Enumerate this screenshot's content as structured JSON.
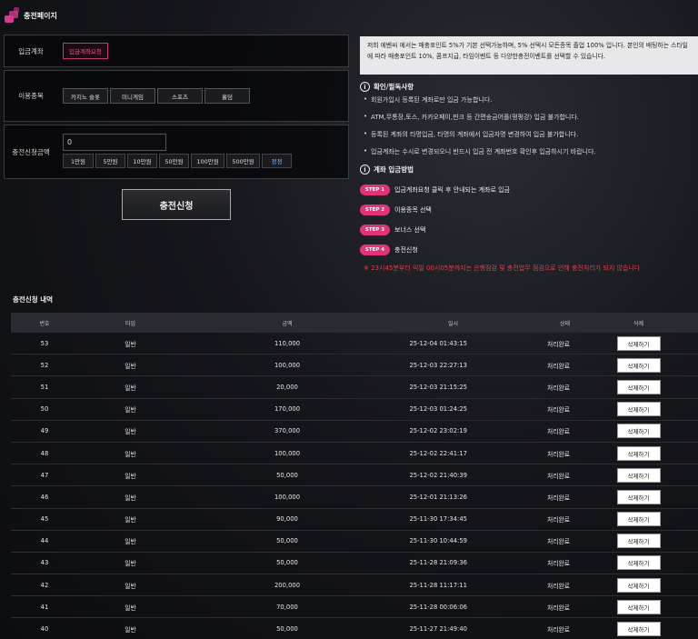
{
  "page": {
    "title": "충전페이지"
  },
  "form": {
    "account_label": "입금계좌",
    "account_button": "입금계좌요청",
    "category_label": "이용종목",
    "categories": [
      "카지노 슬롯",
      "미니게임",
      "스포츠",
      "홀덤"
    ],
    "amount_label": "충전신청금액",
    "amount_value": "0",
    "amount_buttons": [
      "1만원",
      "5만원",
      "10만원",
      "50만원",
      "100만원",
      "500만원"
    ],
    "reset_label": "정정",
    "submit_label": "충전신청"
  },
  "info": {
    "notice": "저희 에벤씨 에서는 매충포인트 5%가 기본 선택가능하며, 5% 선택시 모든종목 졸업 100% 입니다. 본인의 배팅하는 스타일에 따라 매충포인트 10%, 콤프지급, 타임이벤트 등 다양한충전이벤트를 선택할 수 있습니다.",
    "notes_title": "확인/필독사항",
    "notes": [
      "회원가입시 등록된 계좌로만 입금 가능합니다.",
      "ATM,무통장,토스, 카카오페이,핀크 등 간편송금어플(펑펑강) 입금 불가합니다.",
      "등록된 계좌의 타명입금, 타명의 계좌에서 입금자명 변경하여 입금 불가합니다.",
      "입금계좌는 수시로 변경되오니 반드시 입금 전 계좌번호 확인후 입금하시기 바랍니다."
    ],
    "method_title": "계좌 입금방법",
    "steps": [
      {
        "badge": "STEP 1",
        "text": "입금계좌요청 클릭 후 안내되는 계좌로 입금"
      },
      {
        "badge": "STEP 2",
        "text": "이용종목 선택"
      },
      {
        "badge": "STEP 3",
        "text": "보너스 선택"
      },
      {
        "badge": "STEP 4",
        "text": "충전신청"
      }
    ],
    "warning": "※ 23시45분부터 익일 00시05분까지는 은행점검 및 충전업무 점검으로 인해 충전처리가 되지 않습니다"
  },
  "history": {
    "title": "충전신청 내역",
    "columns": [
      "번호",
      "타입",
      "금액",
      "일시",
      "상태",
      "삭제"
    ],
    "delete_label": "삭제하기",
    "rows": [
      {
        "no": "53",
        "type": "일반",
        "amount": "110,000",
        "date": "25-12-04 01:43:15",
        "status": "처리완료"
      },
      {
        "no": "52",
        "type": "일반",
        "amount": "100,000",
        "date": "25-12-03 22:27:13",
        "status": "처리완료"
      },
      {
        "no": "51",
        "type": "일반",
        "amount": "20,000",
        "date": "25-12-03 21:15:25",
        "status": "처리완료"
      },
      {
        "no": "50",
        "type": "일반",
        "amount": "170,000",
        "date": "25-12-03 01:24:25",
        "status": "처리완료"
      },
      {
        "no": "49",
        "type": "일반",
        "amount": "370,000",
        "date": "25-12-02 23:02:19",
        "status": "처리완료"
      },
      {
        "no": "48",
        "type": "일반",
        "amount": "100,000",
        "date": "25-12-02 22:41:17",
        "status": "처리완료"
      },
      {
        "no": "47",
        "type": "일반",
        "amount": "50,000",
        "date": "25-12-02 21:40:39",
        "status": "처리완료"
      },
      {
        "no": "46",
        "type": "일반",
        "amount": "100,000",
        "date": "25-12-01 21:13:26",
        "status": "처리완료"
      },
      {
        "no": "45",
        "type": "일반",
        "amount": "90,000",
        "date": "25-11-30 17:34:45",
        "status": "처리완료"
      },
      {
        "no": "44",
        "type": "일반",
        "amount": "50,000",
        "date": "25-11-30 10:44:59",
        "status": "처리완료"
      },
      {
        "no": "43",
        "type": "일반",
        "amount": "50,000",
        "date": "25-11-28 21:09:36",
        "status": "처리완료"
      },
      {
        "no": "42",
        "type": "일반",
        "amount": "200,000",
        "date": "25-11-28 11:17:11",
        "status": "처리완료"
      },
      {
        "no": "41",
        "type": "일반",
        "amount": "70,000",
        "date": "25-11-28 00:06:06",
        "status": "처리완료"
      },
      {
        "no": "40",
        "type": "일반",
        "amount": "50,000",
        "date": "25-11-27 21:49:40",
        "status": "처리완료"
      }
    ]
  }
}
